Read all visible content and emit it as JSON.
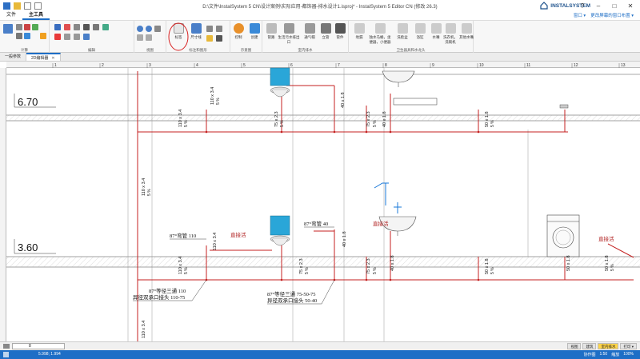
{
  "window": {
    "title": "D:\\文件\\InstalSystem 5 CN\\设计案例\\实际应用-都饰器-排水设计1.isproj* - InstalSystem 5 Editor CN (修改 26.3)",
    "brand": "INSTALSYSTEM"
  },
  "menu": {
    "tabs": [
      "文件",
      "主工具"
    ],
    "right_items": [
      "窗口 ▾",
      "更改屏幕的窗口布置 ▾"
    ]
  },
  "ribbon": {
    "groups": [
      "计算",
      "编辑",
      "视图",
      "标注和图形",
      "示意图",
      "室内排水",
      "卫生器具和水龙头"
    ],
    "buttons": {
      "label": "标签",
      "dimension": "尺寸线",
      "control": "控制",
      "create": "创建",
      "pipe": "管路",
      "fitting": "生活污水排出口",
      "vent": "通气帽",
      "riser": "立管",
      "bend": "管件",
      "floor_drain": "地漏",
      "sink_fixture": "独水马桶，坐便器，小便器",
      "washbasin": "洗脸盆",
      "bathtub": "浴缸",
      "faucet": "水嘴",
      "washer": "洗衣机，洗碗机",
      "other": "其他水嘴"
    }
  },
  "doc_tabs": [
    "一般参数",
    "2D编辑器"
  ],
  "drawing": {
    "elevations": [
      "6.70",
      "3.60"
    ],
    "ruler_top": [
      "1",
      "2",
      "3",
      "4",
      "5",
      "6",
      "7",
      "8",
      "9",
      "10",
      "11",
      "12",
      "13"
    ],
    "pipe_labels_upper": [
      "110 x 3.4",
      "75 x 2.3",
      "40 x 1.8",
      "110 x 3.4",
      "75 x 2.3",
      "40 x 1.8",
      "40 x 1.8",
      "50 x 1.8",
      "50 x 1.8"
    ],
    "slope_label": "5 %",
    "riser_label": "110 x 3.4",
    "annotations": {
      "elbow_110": "87°弯管 110",
      "elbow_40": "87°弯管 40",
      "tee_110": "87°等径三通 110",
      "reducer_110": "异径双承口接头 110-75",
      "tee_75": "87°等径三通 75-50-75",
      "reducer_50": "异径双承口接头 50-40",
      "fixture_1": "直接活",
      "fixture_2": "直接活",
      "fixture_3": "直接活"
    }
  },
  "bottom": {
    "layer_value": "8",
    "view_tabs": [
      "视图",
      "建筑",
      "室内排水",
      "打印 ▾"
    ]
  },
  "status": {
    "coords": "5.998; 1.994",
    "right": [
      "协作图",
      "1:50",
      "缩放",
      "100%"
    ]
  }
}
